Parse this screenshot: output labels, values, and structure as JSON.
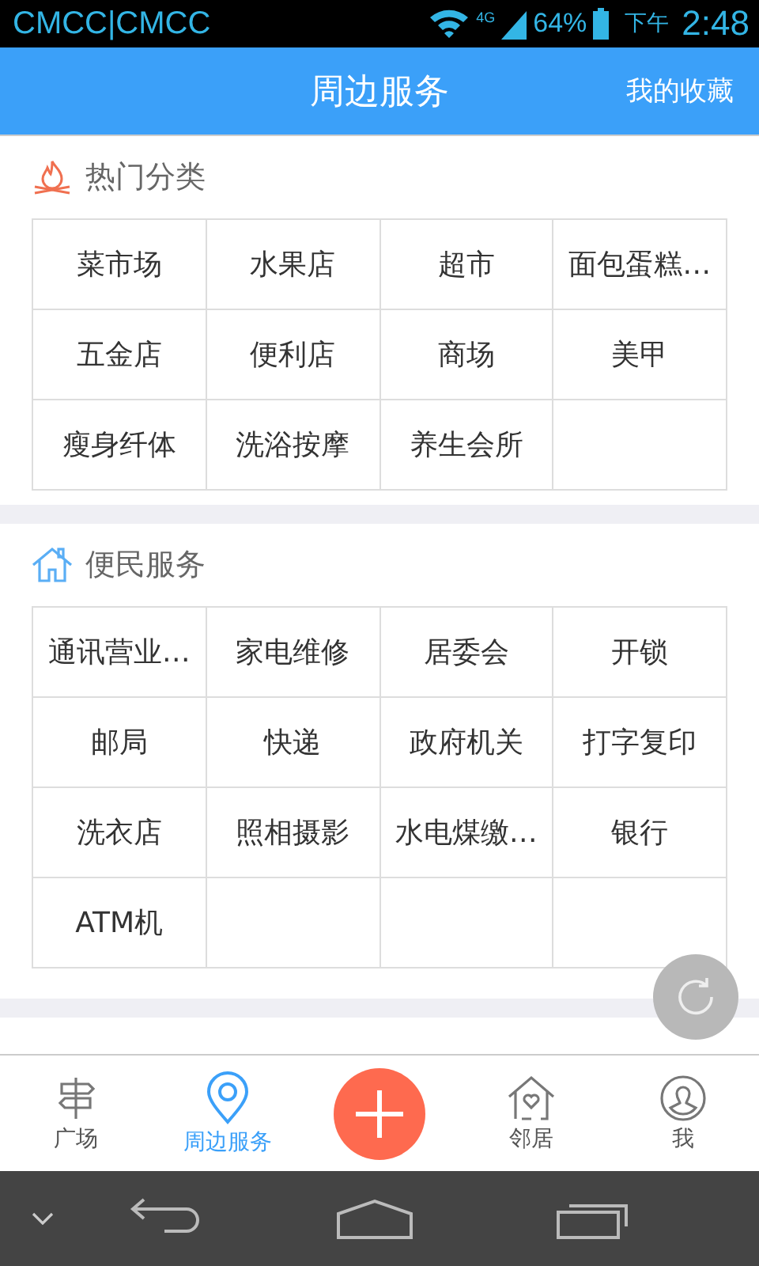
{
  "status_bar": {
    "carrier": "CMCC|CMCC",
    "network": "4G",
    "battery": "64%",
    "period": "下午",
    "time": "2:48"
  },
  "header": {
    "title": "周边服务",
    "action": "我的收藏"
  },
  "sections": [
    {
      "kind": "hot",
      "title": "热门分类",
      "cells": [
        "菜市场",
        "水果店",
        "超市",
        "面包蛋糕…",
        "五金店",
        "便利店",
        "商场",
        "美甲",
        "瘦身纤体",
        "洗浴按摩",
        "养生会所"
      ]
    },
    {
      "kind": "home",
      "title": "便民服务",
      "cells": [
        "通讯营业…",
        "家电维修",
        "居委会",
        "开锁",
        "邮局",
        "快递",
        "政府机关",
        "打字复印",
        "洗衣店",
        "照相摄影",
        "水电煤缴…",
        "银行",
        "ATM机"
      ]
    }
  ],
  "nav": [
    {
      "kind": "sign",
      "label": "广场",
      "selected": false
    },
    {
      "kind": "pin",
      "label": "周边服务",
      "selected": true
    },
    {
      "kind": "add"
    },
    {
      "kind": "house",
      "label": "邻居",
      "selected": false
    },
    {
      "kind": "person",
      "label": "我",
      "selected": false
    }
  ]
}
